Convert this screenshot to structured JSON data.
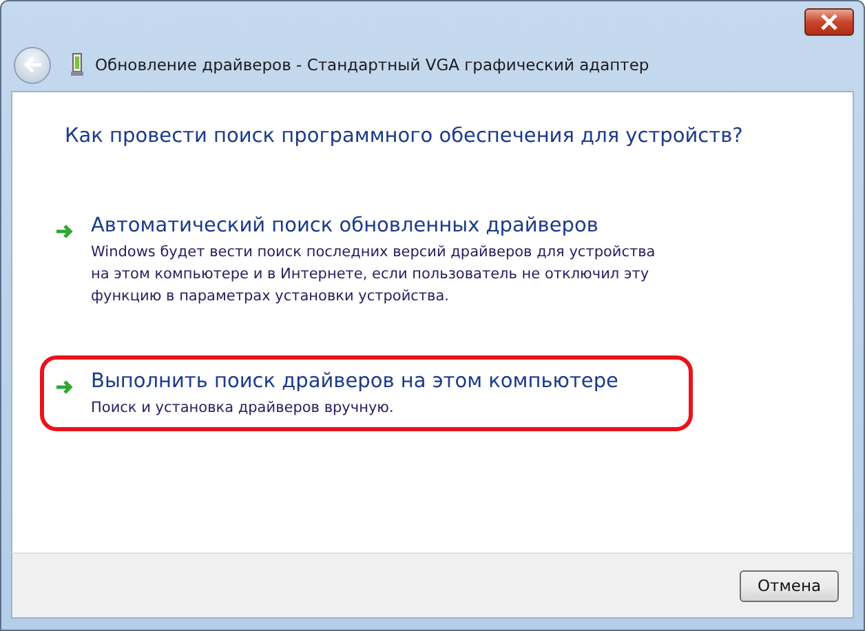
{
  "window": {
    "title": "Обновление драйверов - Стандартный VGA графический адаптер"
  },
  "heading": "Как провести поиск программного обеспечения для устройств?",
  "options": [
    {
      "title": "Автоматический поиск обновленных драйверов",
      "description": "Windows будет вести поиск последних версий драйверов для устройства на этом компьютере и в Интернете, если пользователь не отключил эту функцию в параметрах установки устройства.",
      "highlighted": false
    },
    {
      "title": "Выполнить поиск драйверов на этом компьютере",
      "description": "Поиск и установка драйверов вручную.",
      "highlighted": true
    }
  ],
  "buttons": [
    "Отмена"
  ]
}
